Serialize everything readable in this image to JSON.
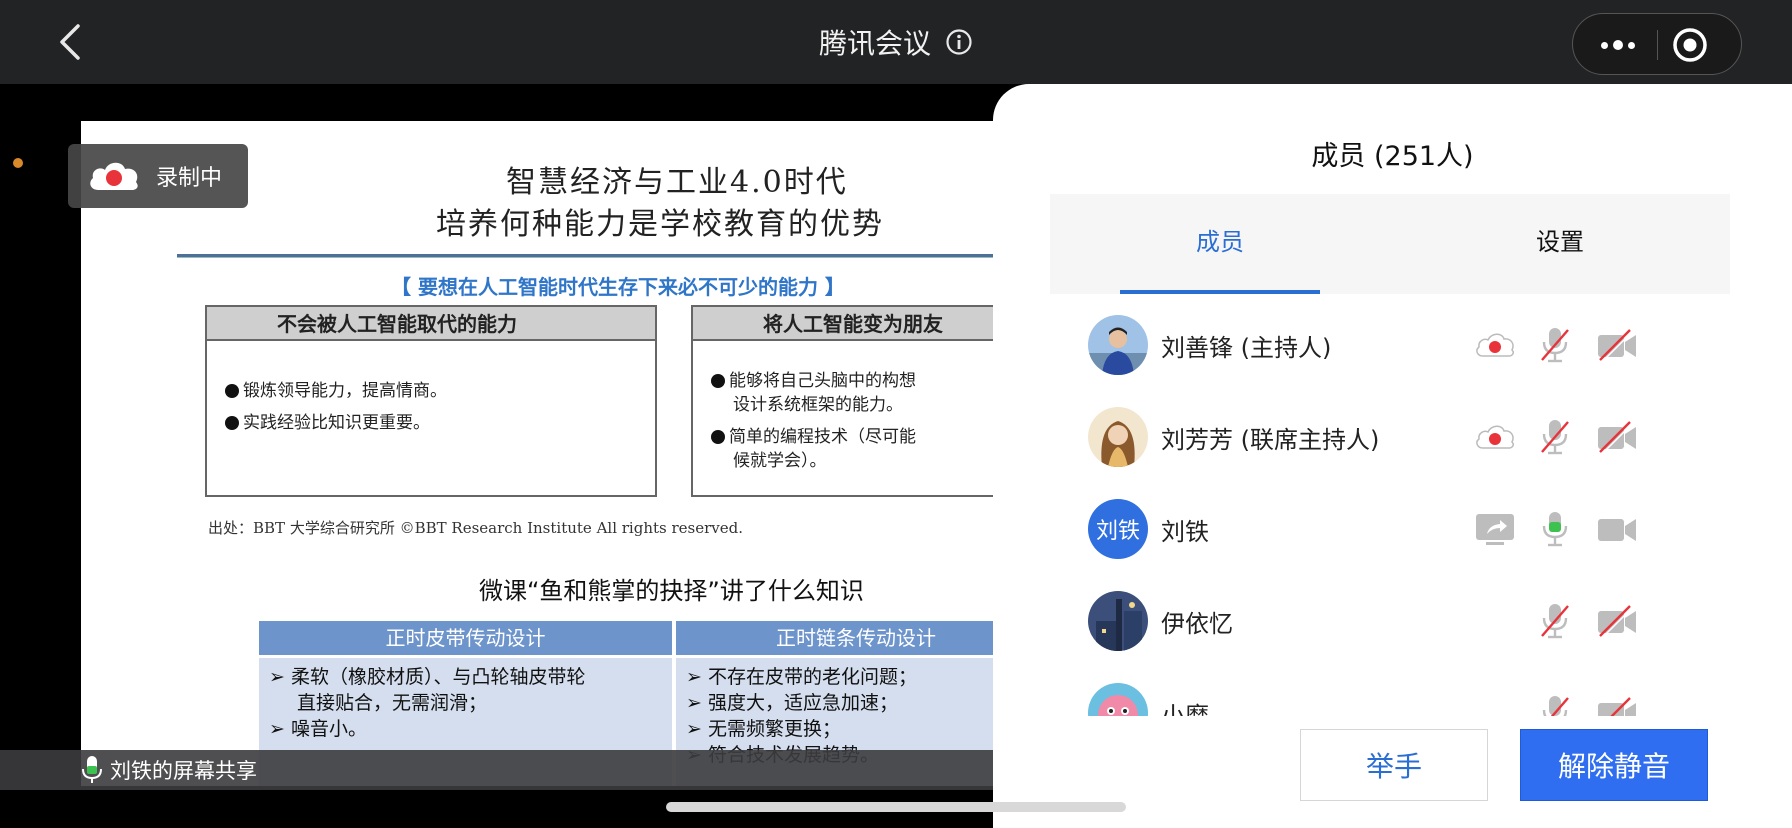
{
  "topbar": {
    "title": "腾讯会议"
  },
  "recording_badge": {
    "label": "录制中"
  },
  "slide": {
    "title_line1": "智慧经济与工业4.0时代",
    "title_line2": "培养何种能力是学校教育的优势",
    "subtitle": "【 要想在人工智能时代生存下来必不可少的能力 】",
    "left_box": {
      "header": "不会被人工智能取代的能力",
      "items": [
        "锻炼领导能力，提高情商。",
        "实践经验比知识更重要。"
      ]
    },
    "right_box": {
      "header": "将人工智能变为朋友",
      "items": [
        {
          "text": "能够将自己头脑中的构想",
          "cont": "设计系统框架的能力。"
        },
        {
          "text": "简单的编程技术（尽可能",
          "cont": "候就学会）。"
        }
      ]
    },
    "source": "出处：BBT 大学综合研究所 ©BBT Research Institute All rights reserved.",
    "section_title": "微课“鱼和熊掌的抉择”讲了什么知识",
    "table": {
      "col1_header": "正时皮带传动设计",
      "col2_header": "正时链条传动设计",
      "col1_items": [
        "➢ 柔软（橡胶材质）、与凸轮轴皮带轮",
        "直接贴合，无需润滑；",
        "➢ 噪音小。"
      ],
      "col2_items": [
        "➢ 不存在皮带的老化问题；",
        "➢ 强度大，适应急加速；",
        "➢ 无需频繁更换；",
        "➢ 符合技术发展趋势。"
      ]
    }
  },
  "share_bar": {
    "label": "刘铁的屏幕共享"
  },
  "panel": {
    "title": "成员 (251人)",
    "tabs": {
      "members": "成员",
      "settings": "设置"
    },
    "members": [
      {
        "name": "刘善锋 (主持人)",
        "recording": true,
        "mic": "muted",
        "cam": "off"
      },
      {
        "name": "刘芳芳 (联席主持人)",
        "recording": true,
        "mic": "muted",
        "cam": "off"
      },
      {
        "name": "刘铁",
        "avatar_text": "刘铁",
        "sharing": true,
        "mic": "active",
        "cam": "on"
      },
      {
        "name": "伊依忆",
        "mic": "muted",
        "cam": "off"
      },
      {
        "name": "小糜",
        "mic": "muted",
        "cam": "off"
      }
    ],
    "raise_hand": "举手",
    "unmute": "解除静音"
  },
  "colors": {
    "accent": "#2a6ed4",
    "primary_button": "#2f6ef0",
    "recording_red": "#e8333a",
    "mute_slash": "#e8333a",
    "mic_active_green": "#3ec24f",
    "topbar": "#222324"
  }
}
